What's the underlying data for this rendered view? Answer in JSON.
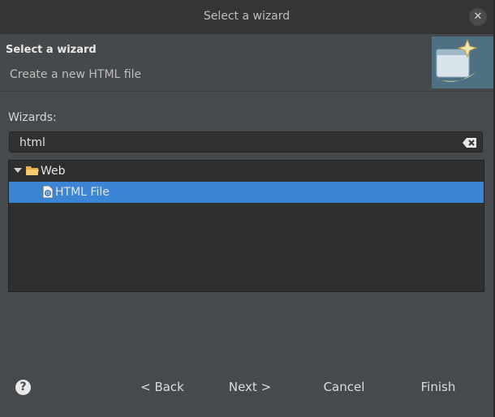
{
  "window": {
    "title": "Select a wizard"
  },
  "header": {
    "title": "Select a wizard",
    "description": "Create a new HTML file"
  },
  "wizards": {
    "label": "Wizards:",
    "filter_value": "html"
  },
  "tree": [
    {
      "label": "Web",
      "expanded": true,
      "icon": "folder-open-icon"
    },
    {
      "label": "HTML File",
      "selected": true,
      "icon": "html-file-icon"
    }
  ],
  "buttons": {
    "back": "< Back",
    "next": "Next >",
    "cancel": "Cancel",
    "finish": "Finish"
  },
  "colors": {
    "selection": "#3c84d4",
    "dialog_bg": "#464a4d",
    "titlebar": "#353535"
  }
}
